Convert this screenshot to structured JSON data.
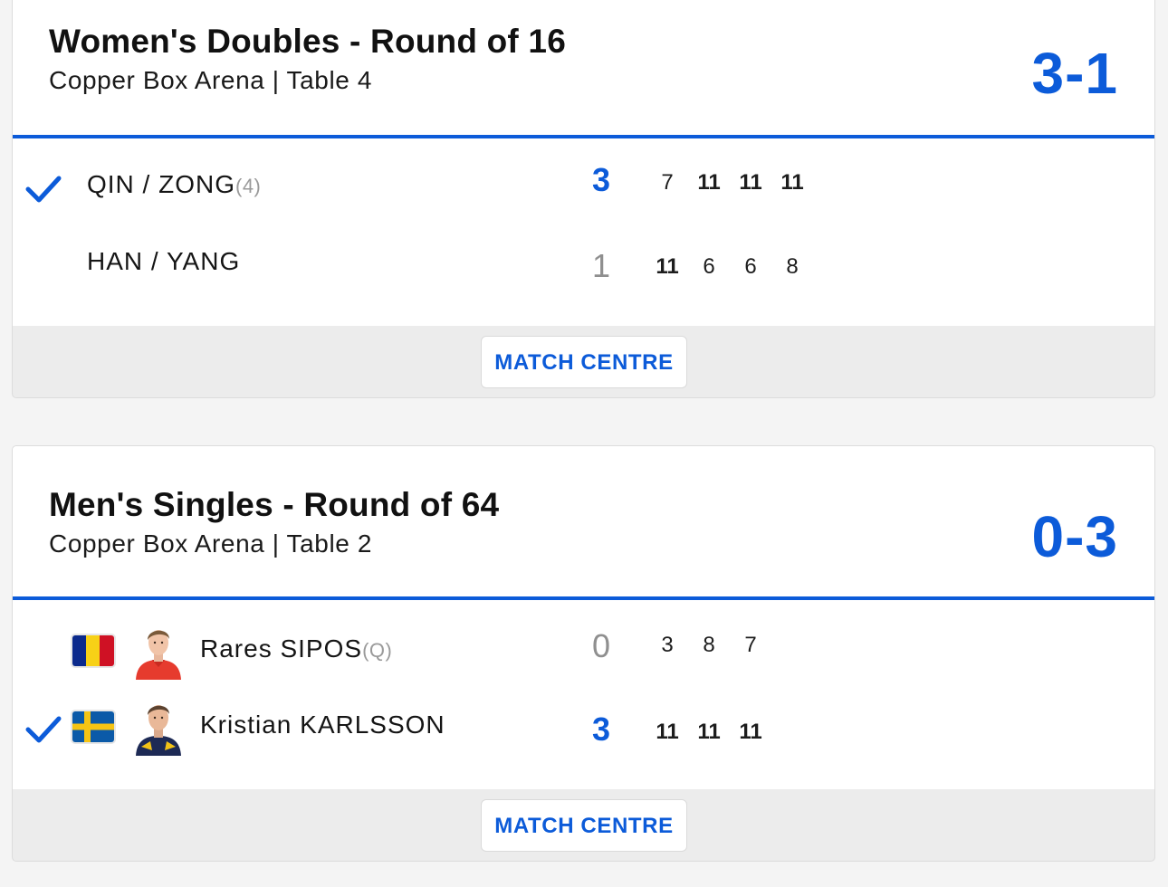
{
  "colors": {
    "accent": "#0c5bd9",
    "winner_check": "#0c5bd9",
    "loser_games": "#8f8f8f"
  },
  "matches": [
    {
      "title": "Women's Doubles - Round of 16",
      "venue": "Copper Box Arena | Table 4",
      "score": "3-1",
      "match_centre_label": "MATCH CENTRE",
      "players": [
        {
          "name": "QIN / ZONG",
          "seed": "(4)",
          "winner": true,
          "games": "3",
          "points": [
            {
              "value": "7",
              "won": false
            },
            {
              "value": "11",
              "won": true
            },
            {
              "value": "11",
              "won": true
            },
            {
              "value": "11",
              "won": true
            }
          ]
        },
        {
          "name": "HAN / YANG",
          "seed": "",
          "winner": false,
          "games": "1",
          "points": [
            {
              "value": "11",
              "won": true
            },
            {
              "value": "6",
              "won": false
            },
            {
              "value": "6",
              "won": false
            },
            {
              "value": "8",
              "won": false
            }
          ]
        }
      ]
    },
    {
      "title": "Men's Singles - Round of 64",
      "venue": "Copper Box Arena | Table 2",
      "score": "0-3",
      "match_centre_label": "MATCH CENTRE",
      "players": [
        {
          "name": "Rares SIPOS",
          "seed": "(Q)",
          "winner": false,
          "flag_icon": "romania-flag-icon",
          "avatar_icon": "player-photo-sipos",
          "games": "0",
          "points": [
            {
              "value": "3",
              "won": false
            },
            {
              "value": "8",
              "won": false
            },
            {
              "value": "7",
              "won": false
            }
          ]
        },
        {
          "name": "Kristian KARLSSON",
          "seed": "",
          "winner": true,
          "flag_icon": "sweden-flag-icon",
          "avatar_icon": "player-photo-karlsson",
          "games": "3",
          "points": [
            {
              "value": "11",
              "won": true
            },
            {
              "value": "11",
              "won": true
            },
            {
              "value": "11",
              "won": true
            }
          ]
        }
      ]
    }
  ]
}
